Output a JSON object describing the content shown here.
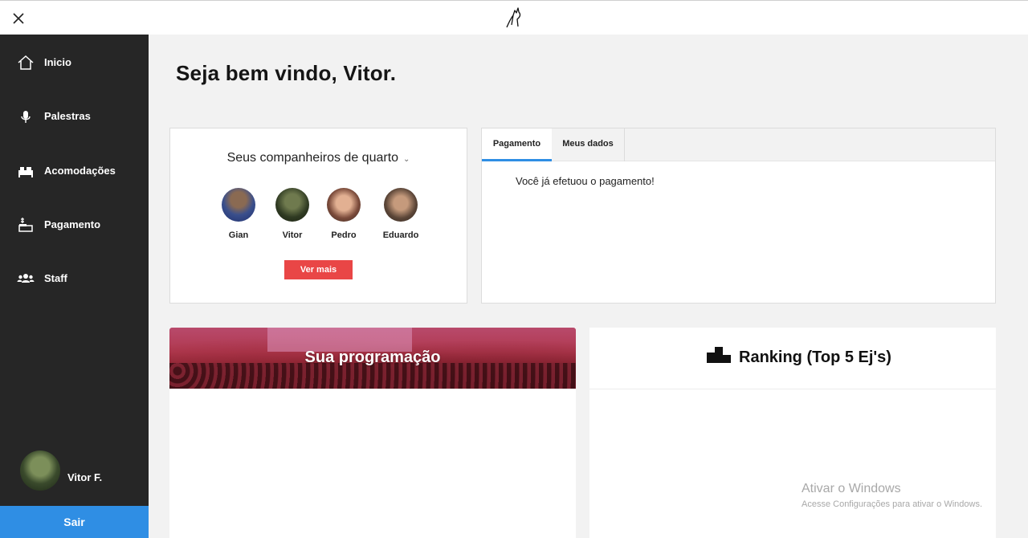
{
  "topbar": {
    "close_icon": "close-icon",
    "logo_icon": "wolf-logo-icon"
  },
  "sidebar": {
    "items": [
      {
        "label": "Inicio",
        "icon": "home-icon"
      },
      {
        "label": "Palestras",
        "icon": "microphone-icon"
      },
      {
        "label": "Acomodações",
        "icon": "bed-icon"
      },
      {
        "label": "Pagamento",
        "icon": "payment-icon"
      },
      {
        "label": "Staff",
        "icon": "group-icon"
      }
    ],
    "profile": {
      "name": "Vitor F."
    },
    "logout_label": "Sair",
    "logout_color": "#2f8ee4"
  },
  "main": {
    "welcome": "Seja bem vindo, Vitor.",
    "roommates": {
      "title": "Seus companheiros de quarto",
      "mates": [
        {
          "name": "Gian"
        },
        {
          "name": "Vitor"
        },
        {
          "name": "Pedro"
        },
        {
          "name": "Eduardo"
        }
      ],
      "button_label": "Ver mais",
      "button_color": "#e94646"
    },
    "tabs": {
      "items": [
        {
          "label": "Pagamento",
          "active": true
        },
        {
          "label": "Meus dados",
          "active": false
        }
      ],
      "content": "Você já efetuou o pagamento!"
    },
    "schedule": {
      "title": "Sua programação"
    },
    "ranking": {
      "title": "Ranking (Top 5 Ej's)",
      "icon": "podium-icon"
    }
  },
  "watermark": {
    "line1": "Ativar o Windows",
    "line2": "Acesse Configurações para ativar o Windows."
  }
}
